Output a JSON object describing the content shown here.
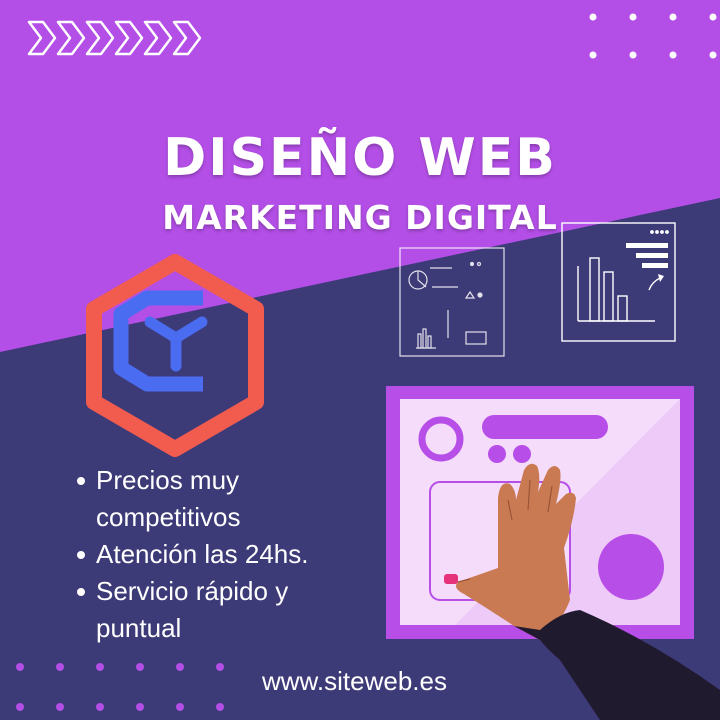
{
  "headline": "DISEÑO WEB",
  "subheadline": "MARKETING DIGITAL",
  "bullets": [
    "Precios muy competitivos",
    "Atención las 24hs.",
    "Servicio rápido y puntual"
  ],
  "website": "www.siteweb.es",
  "colors": {
    "purple_background": "#b34fe6",
    "navy_background": "#3d3a78",
    "logo_red": "#f25c4f",
    "logo_blue": "#4a6cf0",
    "panel_purple": "#b84ee8",
    "panel_light": "#f5dcfb"
  },
  "decorations": {
    "chevron_count": 6,
    "logo": "hexagon-cube-logo",
    "illustration": "hand-touching-screen"
  }
}
